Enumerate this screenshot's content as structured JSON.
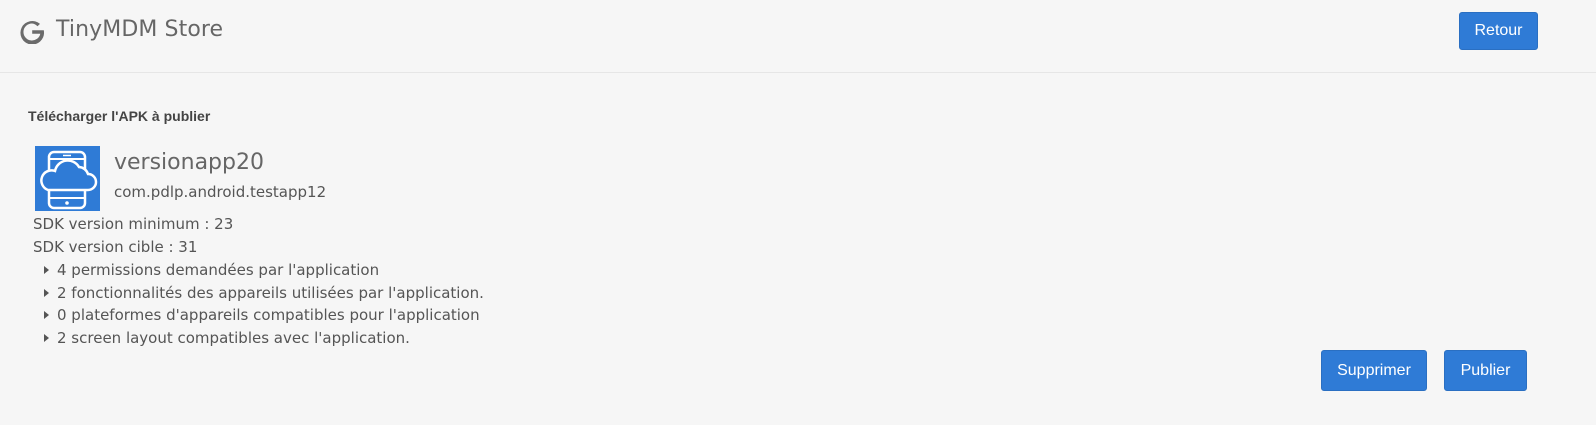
{
  "header": {
    "logo_icon": "google-g-icon",
    "title": "TinyMDM Store",
    "back_label": "Retour"
  },
  "main": {
    "section_title": "Télécharger l'APK à publier",
    "app": {
      "icon": "cloud-phone-icon",
      "name": "versionapp20",
      "package": "com.pdlp.android.testapp12",
      "sdk_min": "SDK version minimum : 23",
      "sdk_target": "SDK version cible : 31"
    },
    "details": [
      "4 permissions demandées par l'application",
      "2 fonctionnalités des appareils utilisées par l'application.",
      "0 plateformes d'appareils compatibles pour l'application",
      "2 screen layout compatibles avec l'application."
    ],
    "delete_label": "Supprimer",
    "publish_label": "Publier"
  },
  "colors": {
    "accent": "#2f7bd6",
    "background": "#f6f6f6"
  }
}
